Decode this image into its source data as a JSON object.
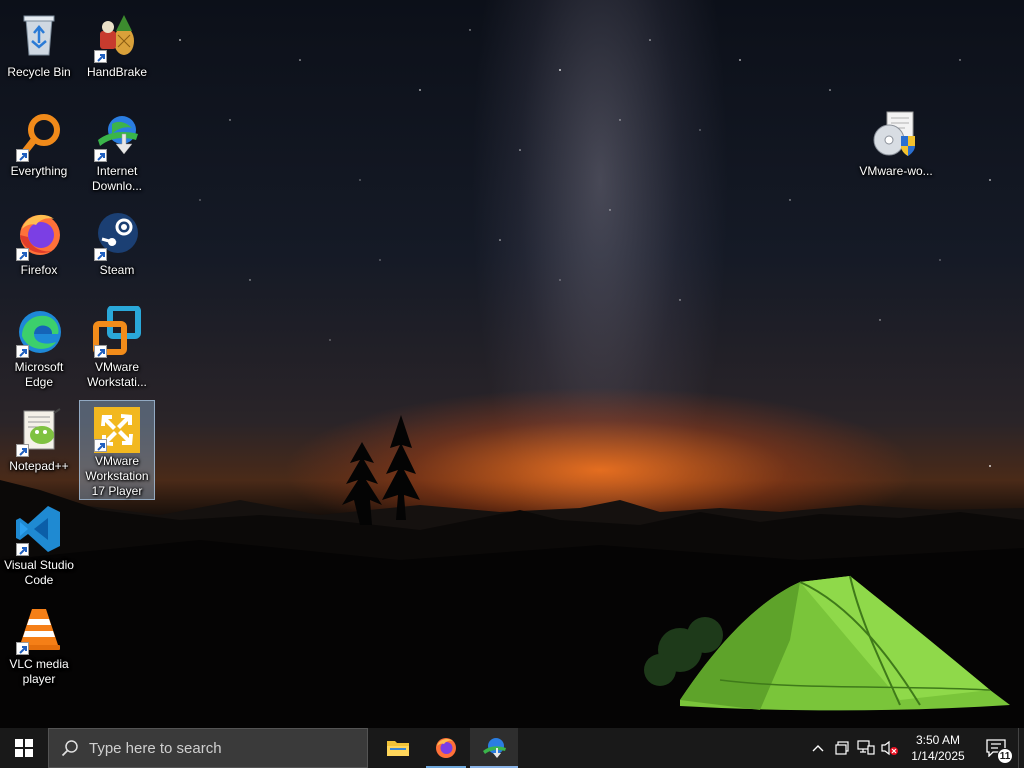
{
  "desktop": {
    "icons": [
      {
        "label": "Recycle Bin",
        "icon": "recycle-bin-icon"
      },
      {
        "label": "HandBrake",
        "icon": "handbrake-icon"
      },
      {
        "label": "Everything",
        "icon": "everything-search-icon"
      },
      {
        "label": "Internet\nDownlo...",
        "icon": "internet-download-manager-icon"
      },
      {
        "label": "Firefox",
        "icon": "firefox-icon"
      },
      {
        "label": "Steam",
        "icon": "steam-icon"
      },
      {
        "label": "Microsoft\nEdge",
        "icon": "edge-icon"
      },
      {
        "label": "VMware\nWorkstati...",
        "icon": "vmware-workstation-icon"
      },
      {
        "label": "Notepad++",
        "icon": "notepad-plus-plus-icon"
      },
      {
        "label": "VMware\nWorkstation\n17 Player",
        "icon": "vmware-player-icon",
        "selected": true
      },
      {
        "label": "Visual Studio\nCode",
        "icon": "vscode-icon"
      },
      {
        "label": "VLC media\nplayer",
        "icon": "vlc-icon"
      },
      {
        "label": "VMware-wo...",
        "icon": "vmware-installer-icon"
      }
    ]
  },
  "taskbar": {
    "search_placeholder": "Type here to search",
    "apps": [
      {
        "name": "File Explorer",
        "icon": "file-explorer-icon"
      },
      {
        "name": "Firefox",
        "icon": "firefox-icon"
      },
      {
        "name": "Internet Download Manager",
        "icon": "internet-download-manager-icon",
        "active": true
      }
    ],
    "tray": {
      "time": "3:50 AM",
      "date": "1/14/2025",
      "notification_count": "11"
    }
  }
}
